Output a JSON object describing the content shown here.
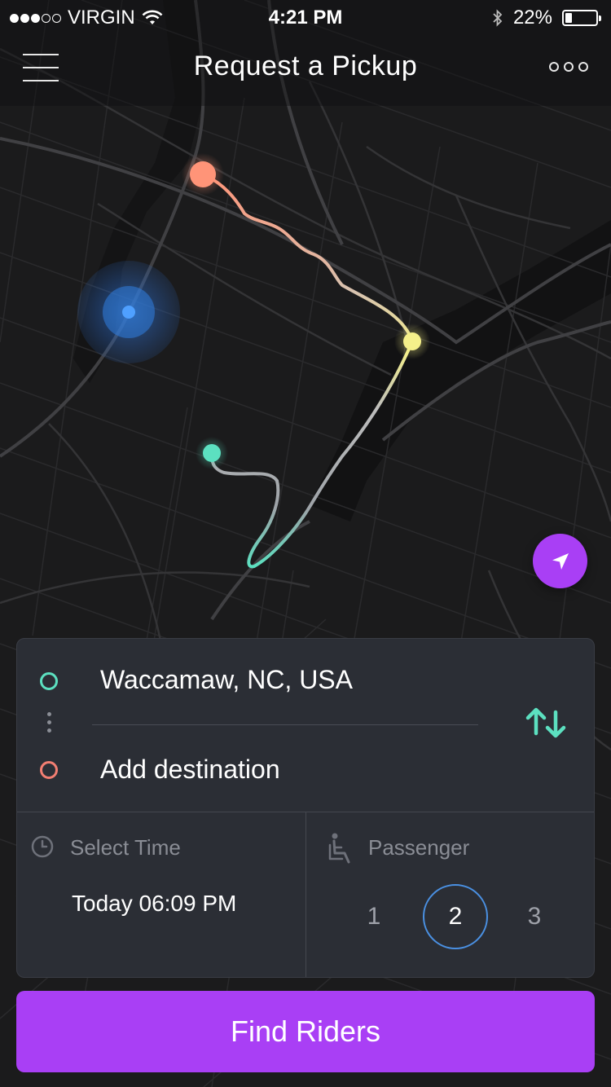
{
  "status_bar": {
    "carrier": "VIRGIN",
    "signal_bars_filled": 3,
    "signal_bars_total": 5,
    "time": "4:21 PM",
    "battery_percent": "22%",
    "battery_level": 0.22
  },
  "nav": {
    "title": "Request a Pickup",
    "menu_icon": "hamburger-menu-icon",
    "more_icon": "more-dots-icon"
  },
  "map": {
    "current_location_color": "#3d8ef5",
    "pickup_color": "#ff9478",
    "waypoint_color": "#f5f08a",
    "route_end_color": "#5ce0c0",
    "locate_icon": "navigation-arrow-icon"
  },
  "route": {
    "origin": "Waccamaw, NC, USA",
    "destination_placeholder": "Add destination",
    "swap_icon": "swap-arrows-icon"
  },
  "schedule": {
    "label": "Select Time",
    "value": "Today 06:09 PM",
    "icon": "clock-icon"
  },
  "passenger": {
    "label": "Passenger",
    "icon": "seat-icon",
    "options": [
      "1",
      "2",
      "3"
    ],
    "selected": "2"
  },
  "cta": {
    "label": "Find Riders"
  },
  "colors": {
    "accent": "#a93ff5",
    "card": "#2b2e35",
    "origin": "#5ce0c0",
    "destination": "#f27e72",
    "selected_ring": "#4a90e2"
  }
}
